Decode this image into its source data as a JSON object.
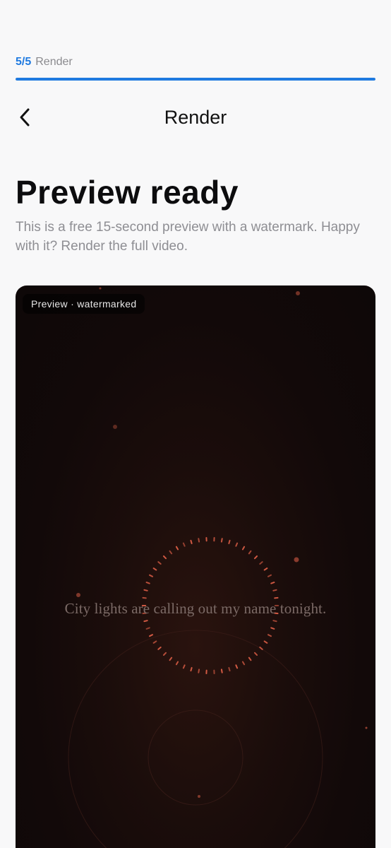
{
  "step": {
    "current": "5/5",
    "label": "Render",
    "progress": 1.0
  },
  "nav": {
    "back_icon": "chevron-left-icon",
    "title": "Render"
  },
  "headline": "Preview ready",
  "subtext": "This is a free 15-second preview with a watermark. Happy with it? Render the full video.",
  "preview": {
    "badge": "Preview · watermarked",
    "lyric": "City lights are calling out my name tonight."
  },
  "colors": {
    "accent": "#1f7ae0",
    "ember": "#e8634a",
    "card_bg": "#120909"
  }
}
